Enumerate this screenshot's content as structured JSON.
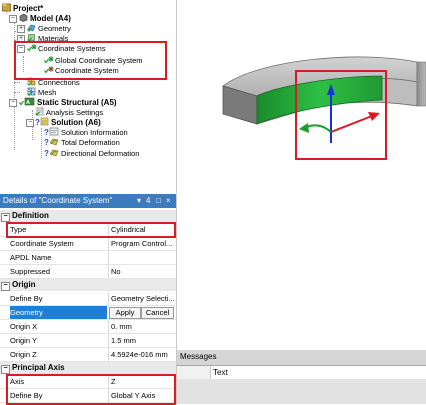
{
  "tree": {
    "project": "Project*",
    "model": "Model (A4)",
    "geometry": "Geometry",
    "materials": "Materials",
    "coordinate_systems": "Coordinate Systems",
    "global_cs": "Global Coordinate System",
    "coordinate_system": "Coordinate System",
    "connections": "Connections",
    "mesh": "Mesh",
    "static_structural": "Static Structural (A5)",
    "analysis_settings": "Analysis Settings",
    "solution": "Solution (A6)",
    "solution_information": "Solution Information",
    "total_deformation": "Total Deformation",
    "directional_deformation": "Directional Deformation"
  },
  "details": {
    "title": "Details of \"Coordinate System\"",
    "title_buttons": [
      "▾",
      "4",
      "□",
      "×"
    ],
    "sections": {
      "definition": "Definition",
      "origin": "Origin",
      "principal_axis": "Principal Axis"
    },
    "rows": {
      "type": {
        "label": "Type",
        "value": "Cylindrical"
      },
      "coordinate_system": {
        "label": "Coordinate System",
        "value": "Program Control..."
      },
      "apdl_name": {
        "label": "APDL Name",
        "value": ""
      },
      "suppressed": {
        "label": "Suppressed",
        "value": "No"
      },
      "define_by": {
        "label": "Define By",
        "value": "Geometry Selecti..."
      },
      "geometry": {
        "label": "Geometry",
        "apply": "Apply",
        "cancel": "Cancel"
      },
      "origin_x": {
        "label": "Origin X",
        "value": "0. mm"
      },
      "origin_y": {
        "label": "Origin Y",
        "value": "1.5 mm"
      },
      "origin_z": {
        "label": "Origin Z",
        "value": "4.5924e-016 mm"
      },
      "axis": {
        "label": "Axis",
        "value": "Z"
      },
      "axis_define_by": {
        "label": "Define By",
        "value": "Global Y Axis"
      }
    }
  },
  "messages": {
    "title": "Messages",
    "column": "Text"
  },
  "colors": {
    "highlight": "#d81b24",
    "title_bar": "#3d7bbf",
    "selected_row": "#1e7fd6",
    "selected_face": "#22b33a",
    "body_gray": "#b5b5b5"
  }
}
